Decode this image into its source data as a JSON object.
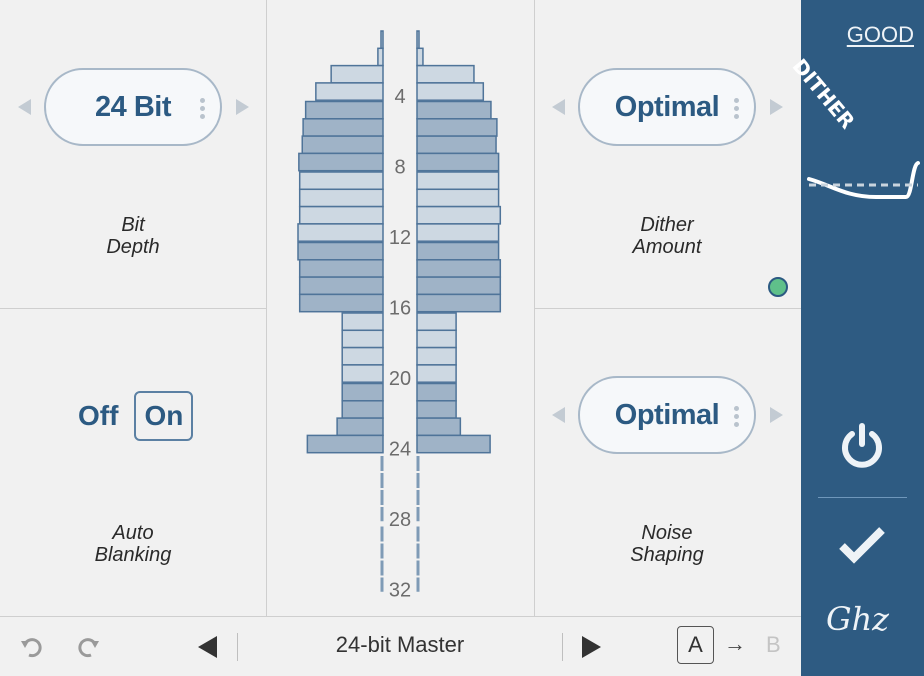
{
  "panels": {
    "bit_depth": {
      "value": "24 Bit",
      "label_line1": "Bit",
      "label_line2": "Depth"
    },
    "dither_amount": {
      "value": "Optimal",
      "label_line1": "Dither",
      "label_line2": "Amount",
      "status_color": "#5fc08a"
    },
    "auto_blanking": {
      "off_label": "Off",
      "on_label": "On",
      "selected": "On",
      "label_line1": "Auto",
      "label_line2": "Blanking"
    },
    "noise_shaping": {
      "value": "Optimal",
      "label_line1": "Noise",
      "label_line2": "Shaping"
    }
  },
  "meter": {
    "tick_labels": [
      "4",
      "8",
      "12",
      "16",
      "20",
      "24",
      "28",
      "32"
    ],
    "active_bits": 24,
    "total_bits": 32,
    "left_levels": [
      0.02,
      0.06,
      0.61,
      0.79,
      0.91,
      0.94,
      0.95,
      0.99,
      0.98,
      0.98,
      0.98,
      1.0,
      1.0,
      0.98,
      0.98,
      0.98,
      0.48,
      0.48,
      0.48,
      0.48,
      0.48,
      0.48,
      0.54,
      0.89
    ],
    "right_levels": [
      0.02,
      0.07,
      0.67,
      0.78,
      0.87,
      0.94,
      0.93,
      0.96,
      0.96,
      0.96,
      0.98,
      0.96,
      0.96,
      0.98,
      0.98,
      0.98,
      0.46,
      0.46,
      0.46,
      0.46,
      0.46,
      0.46,
      0.51,
      0.86
    ],
    "colors": {
      "light": "#cdd8e2",
      "dark": "#9fb3c7",
      "stroke": "#4f7499",
      "tick": "#6c6c6c"
    }
  },
  "sidebar": {
    "quality_label": "GOOD",
    "product_label": "DITHER",
    "brand": "Ghz",
    "background": "#2e5b82"
  },
  "bottom_bar": {
    "preset_name": "24-bit Master",
    "ab_a": "A",
    "ab_arrow": "→",
    "ab_b": "B"
  }
}
